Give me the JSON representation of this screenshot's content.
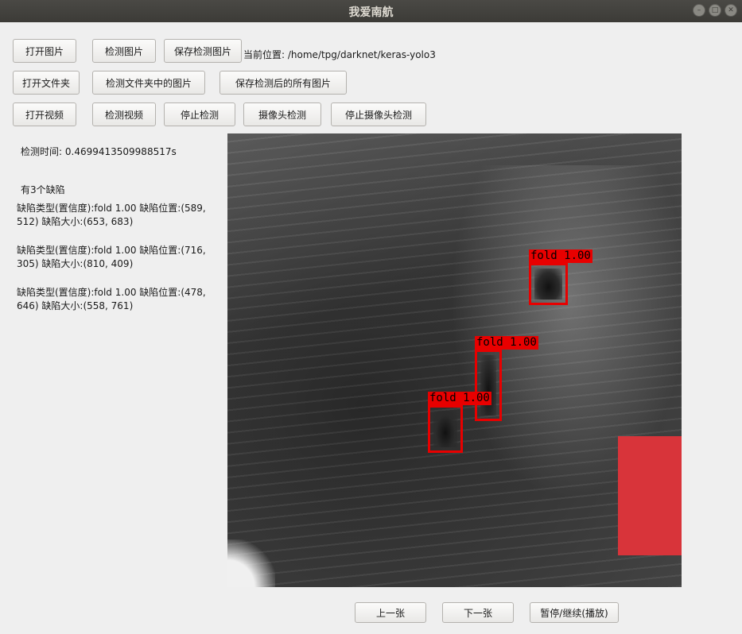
{
  "window": {
    "title": "我爱南航"
  },
  "toolbar": {
    "open_image": "打开图片",
    "detect_image": "检测图片",
    "save_detected_image": "保存检测图片",
    "current_path_label": "当前位置:",
    "current_path": "/home/tpg/darknet/keras-yolo3",
    "open_folder": "打开文件夹",
    "detect_folder_images": "检测文件夹中的图片",
    "save_all_detected": "保存检测后的所有图片",
    "open_video": "打开视频",
    "detect_video": "检测视频",
    "stop_detect": "停止检测",
    "camera_detect": "摄像头检测",
    "stop_camera_detect": "停止摄像头检测"
  },
  "results": {
    "time_label": "检测时间:",
    "time_value": "0.4699413509988517s",
    "count_text": "有3个缺陷",
    "defects": [
      {
        "line1": "缺陷类型(置信度):fold 1.00  缺陷位置:(589,",
        "line2": "512)  缺陷大小:(653, 683)"
      },
      {
        "line1": "缺陷类型(置信度):fold 1.00  缺陷位置:(716,",
        "line2": "305)  缺陷大小:(810, 409)"
      },
      {
        "line1": "缺陷类型(置信度):fold 1.00  缺陷位置:(478,",
        "line2": "646)  缺陷大小:(558, 761)"
      }
    ]
  },
  "image": {
    "detections": [
      {
        "label": "fold 1.00"
      },
      {
        "label": "fold 1.00"
      },
      {
        "label": "fold 1.00"
      }
    ],
    "box_color": "#e80000"
  },
  "nav": {
    "prev": "上一张",
    "next": "下一张",
    "pause_resume": "暂停/继续(播放)"
  }
}
